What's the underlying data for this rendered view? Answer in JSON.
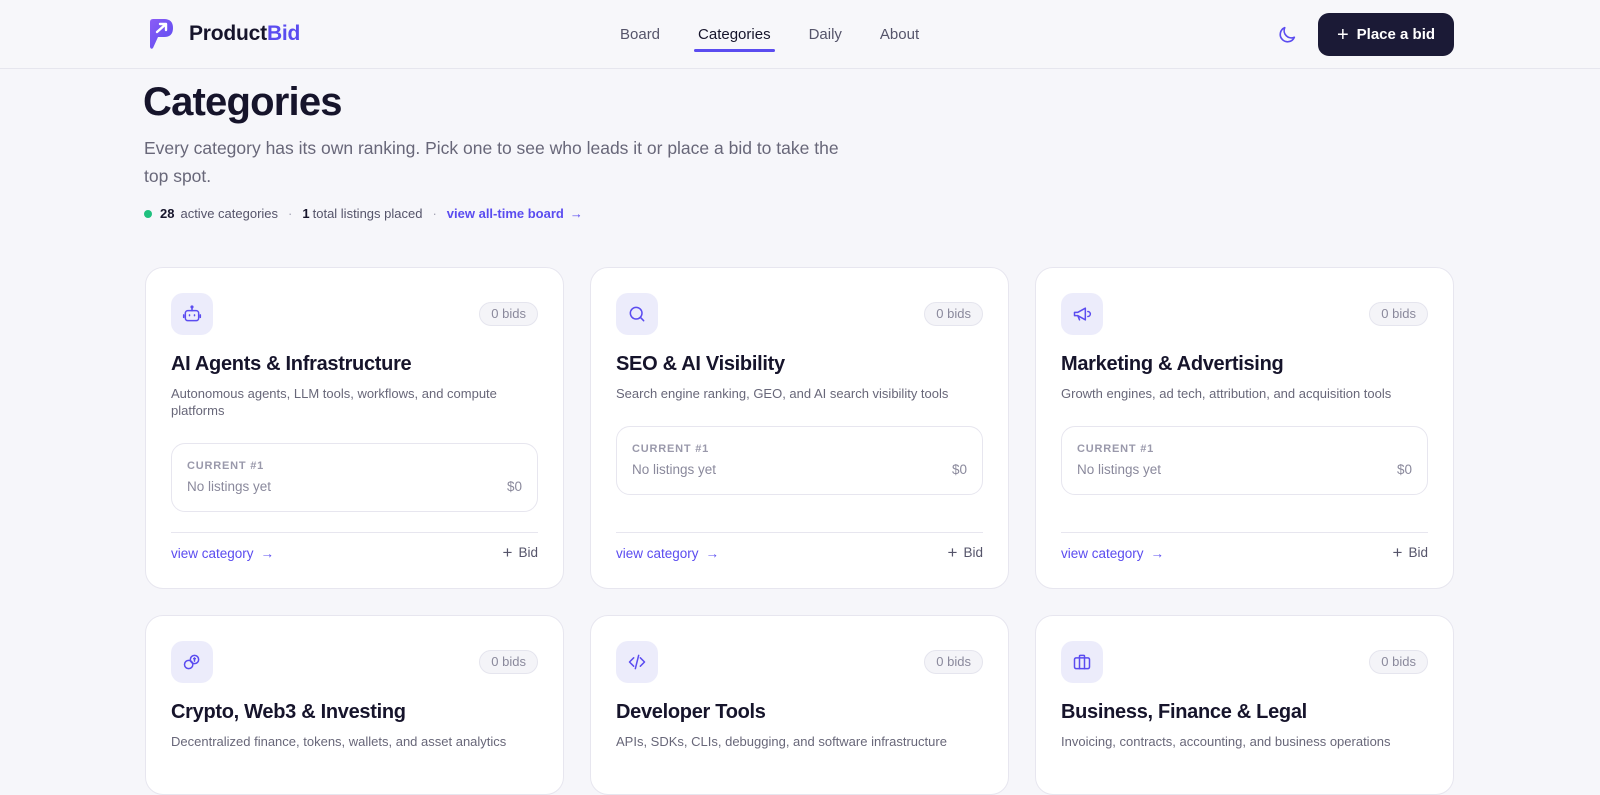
{
  "brand": {
    "name_a": "Product",
    "name_b": "Bid",
    "accent": "#5b4cf0"
  },
  "nav": [
    {
      "label": "Board",
      "active": false
    },
    {
      "label": "Categories",
      "active": true
    },
    {
      "label": "Daily",
      "active": false
    },
    {
      "label": "About",
      "active": false
    }
  ],
  "header": {
    "theme_icon": "moon-icon",
    "place_bid_label": "Place a bid"
  },
  "page": {
    "title": "Categories",
    "subtitle": "Every category has its own ranking. Pick one to see who leads it or place a bid to take the top spot.",
    "stats": {
      "active_count": "28",
      "active_label": "active categories",
      "listings_count": "1",
      "listings_label": "total listings placed",
      "link_label": "view all-time board"
    }
  },
  "card_labels": {
    "current": "CURRENT #1",
    "view": "view category",
    "bid": "Bid"
  },
  "categories": [
    {
      "icon": "robot-icon",
      "bids": "0 bids",
      "title": "AI Agents & Infrastructure",
      "desc": "Autonomous agents, LLM tools, workflows, and compute platforms",
      "current": "No listings yet",
      "amount": "$0"
    },
    {
      "icon": "search-icon",
      "bids": "0 bids",
      "title": "SEO & AI Visibility",
      "desc": "Search engine ranking, GEO, and AI search visibility tools",
      "current": "No listings yet",
      "amount": "$0"
    },
    {
      "icon": "megaphone-icon",
      "bids": "0 bids",
      "title": "Marketing & Advertising",
      "desc": "Growth engines, ad tech, attribution, and acquisition tools",
      "current": "No listings yet",
      "amount": "$0"
    },
    {
      "icon": "coins-icon",
      "bids": "0 bids",
      "title": "Crypto, Web3 & Investing",
      "desc": "Decentralized finance, tokens, wallets, and asset analytics"
    },
    {
      "icon": "code-icon",
      "bids": "0 bids",
      "title": "Developer Tools",
      "desc": "APIs, SDKs, CLIs, debugging, and software infrastructure"
    },
    {
      "icon": "briefcase-icon",
      "bids": "0 bids",
      "title": "Business, Finance & Legal",
      "desc": "Invoicing, contracts, accounting, and business operations"
    }
  ]
}
